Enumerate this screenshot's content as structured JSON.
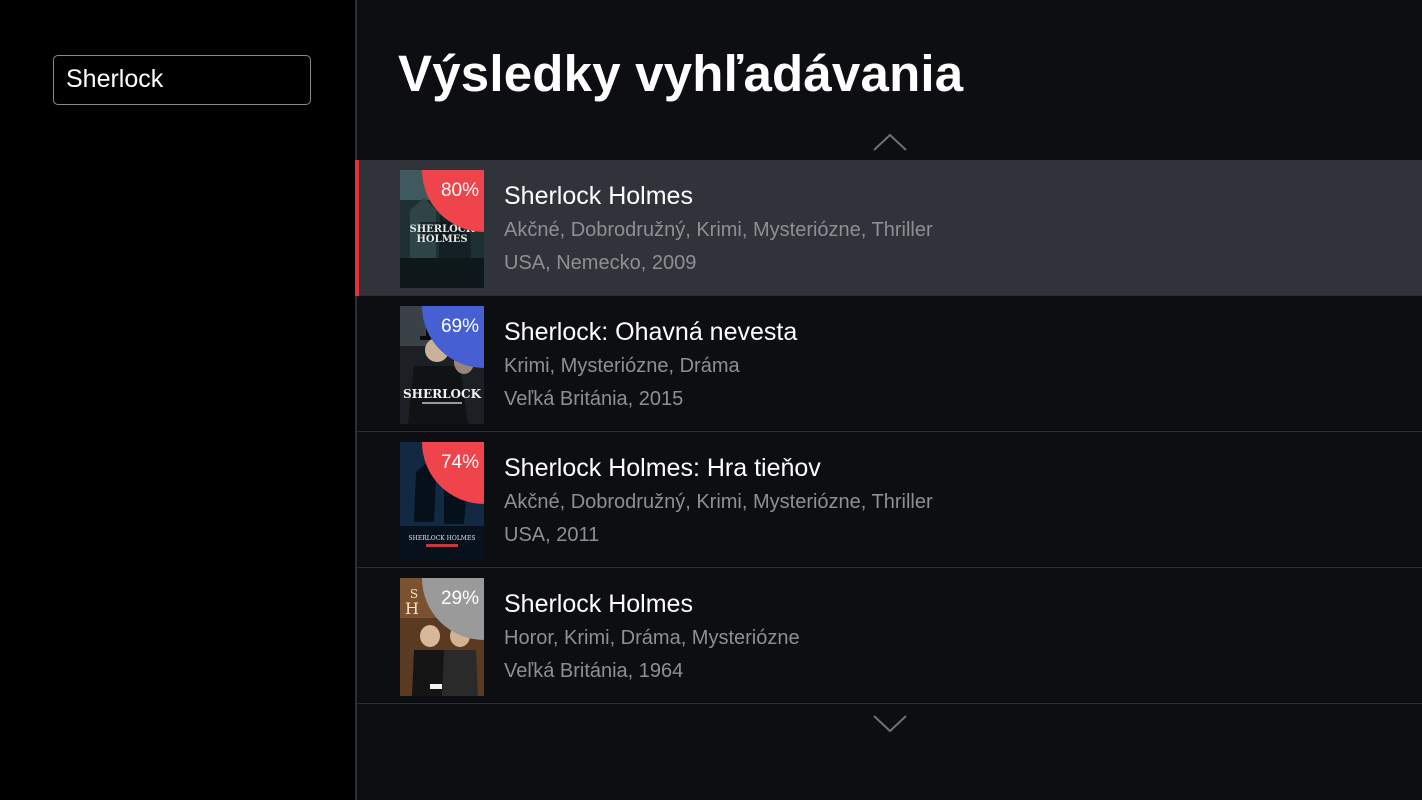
{
  "search": {
    "value": "Sherlock"
  },
  "page_title": "Výsledky vyhľadávania",
  "colors": {
    "accent": "#e8303c",
    "rating_high": "#f0444c",
    "rating_mid": "#4660d3",
    "rating_low": "#9a9a9a"
  },
  "results": [
    {
      "title": "Sherlock Holmes",
      "rating": "80%",
      "rating_color": "#f0444c",
      "genres": "Akčné, Dobrodružný, Krimi, Mysteriózne, Thriller",
      "meta": "USA, Nemecko, 2009",
      "poster_text": [
        "SHERLOCK",
        "HOLMES"
      ],
      "selected": true
    },
    {
      "title": "Sherlock: Ohavná nevesta",
      "rating": "69%",
      "rating_color": "#4660d3",
      "genres": "Krimi, Mysteriózne, Dráma",
      "meta": "Veľká Británia, 2015",
      "poster_text": [
        "SHERLOCK"
      ],
      "selected": false
    },
    {
      "title": "Sherlock Holmes: Hra tieňov",
      "rating": "74%",
      "rating_color": "#f0444c",
      "genres": "Akčné, Dobrodružný, Krimi, Mysteriózne, Thriller",
      "meta": "USA, 2011",
      "poster_text": [
        "SHERLOCK HOLMES"
      ],
      "selected": false
    },
    {
      "title": "Sherlock Holmes",
      "rating": "29%",
      "rating_color": "#9a9a9a",
      "genres": "Horor, Krimi, Dráma, Mysteriózne",
      "meta": "Veľká Británia, 1964",
      "poster_text": [
        "S",
        "H"
      ],
      "selected": false
    }
  ]
}
